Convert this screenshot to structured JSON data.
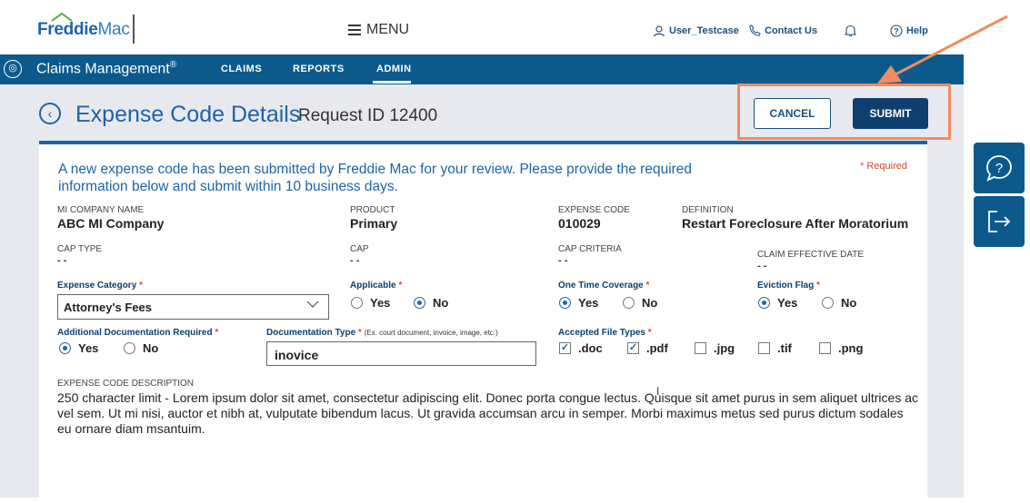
{
  "header": {
    "logo_brand": "Freddie",
    "logo_mac": "Mac",
    "menu_label": "MENU",
    "user_label": "User_Testcase",
    "contact_label": "Contact Us",
    "help_label": "Help"
  },
  "nav": {
    "app_title": "Claims Management",
    "app_title_mark": "®",
    "items": [
      "CLAIMS",
      "REPORTS",
      "ADMIN"
    ],
    "active": "ADMIN"
  },
  "page": {
    "title": "Expense Code Details",
    "request_id": "Request ID 12400",
    "cancel_label": "CANCEL",
    "submit_label": "SUBMIT"
  },
  "form": {
    "intro": "A new expense code has been submitted by Freddie Mac for your review. Please provide the required information below and submit within 10 business days.",
    "required_note": "* Required",
    "mi_company_label": "MI COMPANY NAME",
    "mi_company_value": "ABC MI Company",
    "product_label": "PRODUCT",
    "product_value": "Primary",
    "expense_code_label": "EXPENSE CODE",
    "expense_code_value": "010029",
    "definition_label": "DEFINITION",
    "definition_value": "Restart Foreclosure After Moratorium",
    "cap_type_label": "CAP TYPE",
    "cap_type_value": "- -",
    "cap_label": "CAP",
    "cap_value": "- -",
    "cap_criteria_label": "CAP CRITERIA",
    "cap_criteria_value": "- -",
    "claim_eff_label": "CLAIM EFFECTIVE DATE",
    "claim_eff_value": "- -",
    "expense_category_label": "Expense Category",
    "expense_category_value": "Attorney's Fees",
    "applicable_label": "Applicable",
    "one_time_label": "One Time Coverage",
    "eviction_label": "Eviction Flag",
    "addl_doc_label": "Additional Documentation Required",
    "doc_type_label": "Documentation Type",
    "doc_type_hint": "(Ex. court document, invoice, image, etc.)",
    "doc_type_value": "inovice",
    "accepted_types_label": "Accepted File Types",
    "yes": "Yes",
    "no": "No",
    "asterisk": "*",
    "file_types": [
      ".doc",
      ".pdf",
      ".jpg",
      ".tif",
      ".png"
    ],
    "file_types_checked": [
      true,
      true,
      false,
      false,
      false
    ],
    "applicable_selected": "No",
    "one_time_selected": "Yes",
    "eviction_selected": "Yes",
    "addl_doc_selected": "Yes",
    "description_label": "EXPENSE CODE DESCRIPTION",
    "description_value": "250 character limit - Lorem ipsum dolor sit amet, consectetur adipiscing elit. Donec porta congue lectus. Quisque sit amet purus in sem aliquet ultrices ac vel sem. Ut mi nisi, auctor et nibh at, vulputate bibendum lacus. Ut gravida accumsan arcu in semper. Morbi maximus metus sed purus dictum sodales eu ornare diam msantuim."
  },
  "colors": {
    "brand_blue": "#1e63a8",
    "nav_bg": "#0c5a8c",
    "submit_bg": "#0e3f6e",
    "highlight": "#f08c60",
    "required_red": "#d24b2a"
  }
}
